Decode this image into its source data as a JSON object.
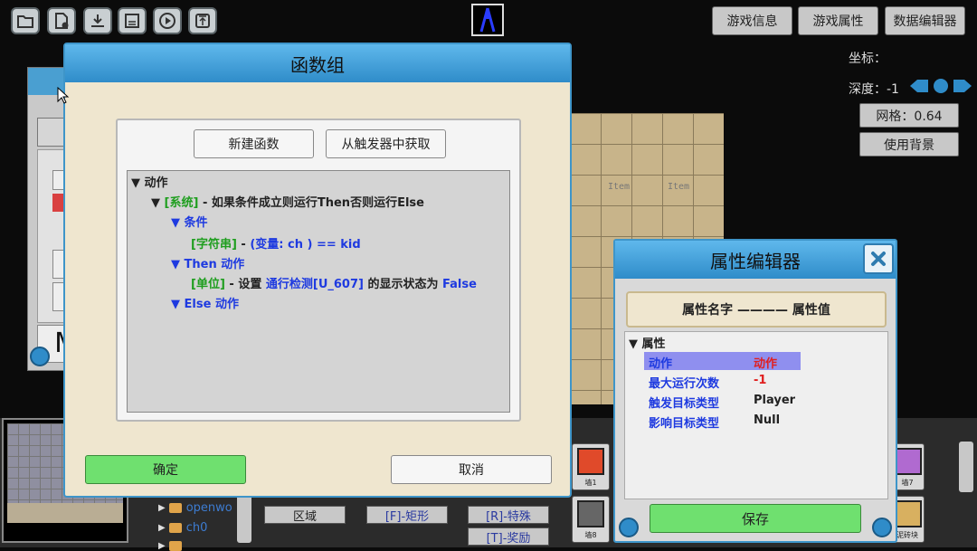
{
  "toolbar": {
    "icons": [
      "folder-icon",
      "new-file-icon",
      "download-icon",
      "save-icon",
      "play-icon",
      "upload-icon"
    ]
  },
  "top_right": {
    "game_info": "游戏信息",
    "game_props": "游戏属性",
    "data_editor": "数据编辑器"
  },
  "side": {
    "coord_label": "坐标：",
    "depth_label": "深度：-1",
    "grid_label": "网格：0.64",
    "use_bg_label": "使用背景"
  },
  "map": {
    "items": [
      "Item",
      "Item"
    ]
  },
  "left_panel": {
    "letter": "M"
  },
  "tree": {
    "rows": [
      "openwo",
      "ch0"
    ]
  },
  "categories": {
    "region": "区域",
    "rect": "[F]-矩形",
    "special": "[R]-特殊",
    "reward": "[T]-奖励"
  },
  "tiles": {
    "wall1": "墙1",
    "wall8": "墙8",
    "wall7": "墙7",
    "brick": "泥砖块"
  },
  "dialog": {
    "title": "函数组",
    "new_function": "新建函数",
    "from_trigger": "从触发器中获取",
    "ok": "确定",
    "cancel": "取消",
    "code": {
      "actions_header": "▼ 动作",
      "system_tag": "[系统]",
      "system_text": " - 如果条件成立则运行Then否则运行Else",
      "conditions_header": "▼ 条件",
      "string_tag": "[字符串]",
      "string_sep": " - ",
      "string_text": "(变量: ch )  ==  kid",
      "then_header": "▼ Then 动作",
      "unit_tag": "[单位]",
      "unit_text_1": " - 设置 ",
      "unit_target": "通行检测[U_607]",
      "unit_text_2": " 的显示状态为 ",
      "unit_value": "False",
      "else_header": "▼ Else 动作"
    }
  },
  "property_editor": {
    "title": "属性编辑器",
    "header": "属性名字 ———— 属性值",
    "group": "▼ 属性",
    "rows": [
      {
        "name": "动作",
        "value": "动作"
      },
      {
        "name": "最大运行次数",
        "value": "-1"
      },
      {
        "name": "触发目标类型",
        "value": "Player"
      },
      {
        "name": "影响目标类型",
        "value": "Null"
      }
    ],
    "save": "保存"
  },
  "colors": {
    "title_bar_blue": "#2f8cc9",
    "ok_green": "#6fe06f",
    "tag_green": "#1e9e1e",
    "keyword_blue": "#1e3ae0",
    "value_red": "#e02020",
    "selected_row": "#8f8fef"
  }
}
